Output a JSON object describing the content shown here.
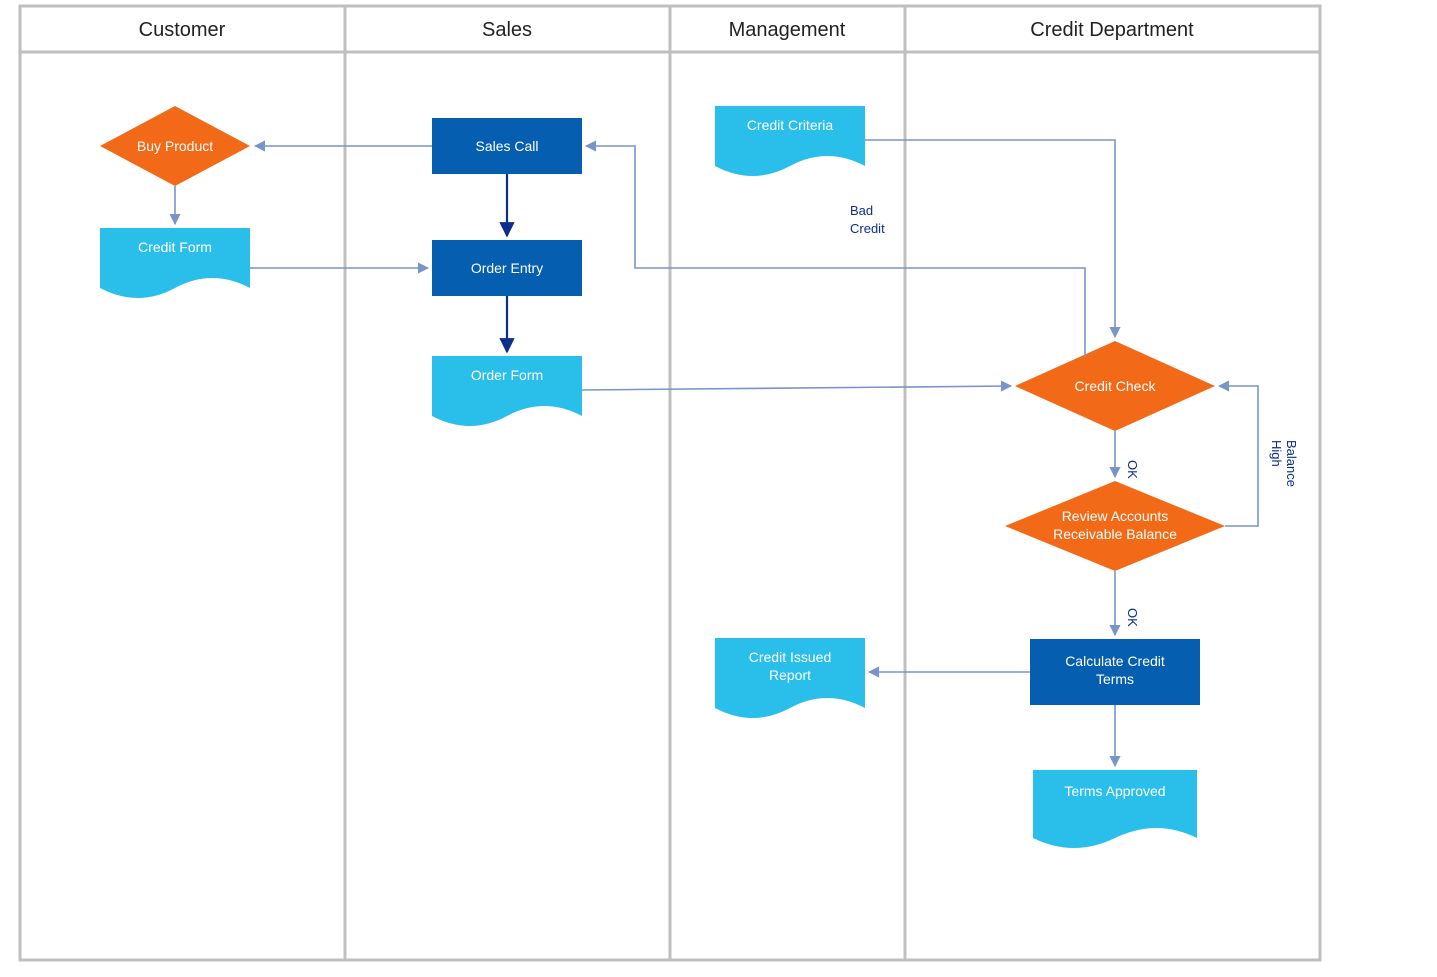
{
  "lanes": [
    {
      "id": "customer",
      "label": "Customer"
    },
    {
      "id": "sales",
      "label": "Sales"
    },
    {
      "id": "management",
      "label": "Management"
    },
    {
      "id": "credit",
      "label": "Credit Department"
    }
  ],
  "nodes": {
    "buy_product": {
      "label": "Buy Product",
      "shape": "decision",
      "lane": "customer"
    },
    "credit_form": {
      "label": "Credit Form",
      "shape": "document",
      "lane": "customer"
    },
    "sales_call": {
      "label": "Sales Call",
      "shape": "process",
      "lane": "sales"
    },
    "order_entry": {
      "label": "Order Entry",
      "shape": "process",
      "lane": "sales"
    },
    "order_form": {
      "label": "Order Form",
      "shape": "document",
      "lane": "sales"
    },
    "credit_criteria": {
      "label": "Credit Criteria",
      "shape": "document",
      "lane": "management"
    },
    "credit_issued": {
      "label": "Credit Issued",
      "shape": "document",
      "lane": "management",
      "label2": "Report"
    },
    "credit_check": {
      "label": "Credit Check",
      "shape": "decision",
      "lane": "credit"
    },
    "review_ar": {
      "label": "Review Accounts",
      "shape": "decision",
      "lane": "credit",
      "label2": "Receivable Balance"
    },
    "calc_terms": {
      "label": "Calculate Credit",
      "shape": "process",
      "lane": "credit",
      "label2": "Terms"
    },
    "terms_approved": {
      "label": "Terms Approved",
      "shape": "document",
      "lane": "credit"
    }
  },
  "edges": [
    {
      "from": "sales_call",
      "to": "buy_product"
    },
    {
      "from": "buy_product",
      "to": "credit_form"
    },
    {
      "from": "credit_form",
      "to": "order_entry"
    },
    {
      "from": "sales_call",
      "to": "order_entry"
    },
    {
      "from": "order_entry",
      "to": "order_form"
    },
    {
      "from": "order_form",
      "to": "credit_check"
    },
    {
      "from": "credit_criteria",
      "to": "credit_check"
    },
    {
      "from": "credit_check",
      "to": "sales_call",
      "label": "Bad Credit",
      "label2": ""
    },
    {
      "from": "credit_check",
      "to": "review_ar",
      "label": "OK"
    },
    {
      "from": "review_ar",
      "to": "credit_check",
      "label": "High",
      "label2": "Balance"
    },
    {
      "from": "review_ar",
      "to": "calc_terms",
      "label": "OK"
    },
    {
      "from": "calc_terms",
      "to": "credit_issued"
    },
    {
      "from": "calc_terms",
      "to": "terms_approved"
    }
  ],
  "colors": {
    "lane_border": "#bfbfbf",
    "process_fill": "#055eb0",
    "decision_fill": "#f26a18",
    "document_fill": "#2abfea",
    "arrow": "#7795c9",
    "arrow_dark": "#0a2e8a"
  }
}
